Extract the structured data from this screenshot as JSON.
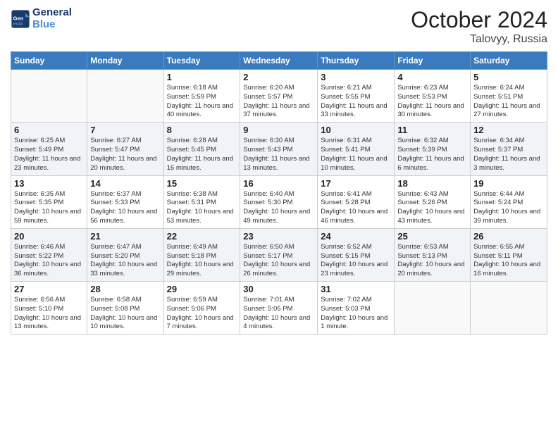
{
  "logo": {
    "line1": "General",
    "line2": "Blue"
  },
  "title": "October 2024",
  "location": "Talovyy, Russia",
  "days_of_week": [
    "Sunday",
    "Monday",
    "Tuesday",
    "Wednesday",
    "Thursday",
    "Friday",
    "Saturday"
  ],
  "weeks": [
    [
      {
        "day": "",
        "info": ""
      },
      {
        "day": "",
        "info": ""
      },
      {
        "day": "1",
        "info": "Sunrise: 6:18 AM\nSunset: 5:59 PM\nDaylight: 11 hours and 40 minutes."
      },
      {
        "day": "2",
        "info": "Sunrise: 6:20 AM\nSunset: 5:57 PM\nDaylight: 11 hours and 37 minutes."
      },
      {
        "day": "3",
        "info": "Sunrise: 6:21 AM\nSunset: 5:55 PM\nDaylight: 11 hours and 33 minutes."
      },
      {
        "day": "4",
        "info": "Sunrise: 6:23 AM\nSunset: 5:53 PM\nDaylight: 11 hours and 30 minutes."
      },
      {
        "day": "5",
        "info": "Sunrise: 6:24 AM\nSunset: 5:51 PM\nDaylight: 11 hours and 27 minutes."
      }
    ],
    [
      {
        "day": "6",
        "info": "Sunrise: 6:25 AM\nSunset: 5:49 PM\nDaylight: 11 hours and 23 minutes."
      },
      {
        "day": "7",
        "info": "Sunrise: 6:27 AM\nSunset: 5:47 PM\nDaylight: 11 hours and 20 minutes."
      },
      {
        "day": "8",
        "info": "Sunrise: 6:28 AM\nSunset: 5:45 PM\nDaylight: 11 hours and 16 minutes."
      },
      {
        "day": "9",
        "info": "Sunrise: 6:30 AM\nSunset: 5:43 PM\nDaylight: 11 hours and 13 minutes."
      },
      {
        "day": "10",
        "info": "Sunrise: 6:31 AM\nSunset: 5:41 PM\nDaylight: 11 hours and 10 minutes."
      },
      {
        "day": "11",
        "info": "Sunrise: 6:32 AM\nSunset: 5:39 PM\nDaylight: 11 hours and 6 minutes."
      },
      {
        "day": "12",
        "info": "Sunrise: 6:34 AM\nSunset: 5:37 PM\nDaylight: 11 hours and 3 minutes."
      }
    ],
    [
      {
        "day": "13",
        "info": "Sunrise: 6:35 AM\nSunset: 5:35 PM\nDaylight: 10 hours and 59 minutes."
      },
      {
        "day": "14",
        "info": "Sunrise: 6:37 AM\nSunset: 5:33 PM\nDaylight: 10 hours and 56 minutes."
      },
      {
        "day": "15",
        "info": "Sunrise: 6:38 AM\nSunset: 5:31 PM\nDaylight: 10 hours and 53 minutes."
      },
      {
        "day": "16",
        "info": "Sunrise: 6:40 AM\nSunset: 5:30 PM\nDaylight: 10 hours and 49 minutes."
      },
      {
        "day": "17",
        "info": "Sunrise: 6:41 AM\nSunset: 5:28 PM\nDaylight: 10 hours and 46 minutes."
      },
      {
        "day": "18",
        "info": "Sunrise: 6:43 AM\nSunset: 5:26 PM\nDaylight: 10 hours and 43 minutes."
      },
      {
        "day": "19",
        "info": "Sunrise: 6:44 AM\nSunset: 5:24 PM\nDaylight: 10 hours and 39 minutes."
      }
    ],
    [
      {
        "day": "20",
        "info": "Sunrise: 6:46 AM\nSunset: 5:22 PM\nDaylight: 10 hours and 36 minutes."
      },
      {
        "day": "21",
        "info": "Sunrise: 6:47 AM\nSunset: 5:20 PM\nDaylight: 10 hours and 33 minutes."
      },
      {
        "day": "22",
        "info": "Sunrise: 6:49 AM\nSunset: 5:18 PM\nDaylight: 10 hours and 29 minutes."
      },
      {
        "day": "23",
        "info": "Sunrise: 6:50 AM\nSunset: 5:17 PM\nDaylight: 10 hours and 26 minutes."
      },
      {
        "day": "24",
        "info": "Sunrise: 6:52 AM\nSunset: 5:15 PM\nDaylight: 10 hours and 23 minutes."
      },
      {
        "day": "25",
        "info": "Sunrise: 6:53 AM\nSunset: 5:13 PM\nDaylight: 10 hours and 20 minutes."
      },
      {
        "day": "26",
        "info": "Sunrise: 6:55 AM\nSunset: 5:11 PM\nDaylight: 10 hours and 16 minutes."
      }
    ],
    [
      {
        "day": "27",
        "info": "Sunrise: 6:56 AM\nSunset: 5:10 PM\nDaylight: 10 hours and 13 minutes."
      },
      {
        "day": "28",
        "info": "Sunrise: 6:58 AM\nSunset: 5:08 PM\nDaylight: 10 hours and 10 minutes."
      },
      {
        "day": "29",
        "info": "Sunrise: 6:59 AM\nSunset: 5:06 PM\nDaylight: 10 hours and 7 minutes."
      },
      {
        "day": "30",
        "info": "Sunrise: 7:01 AM\nSunset: 5:05 PM\nDaylight: 10 hours and 4 minutes."
      },
      {
        "day": "31",
        "info": "Sunrise: 7:02 AM\nSunset: 5:03 PM\nDaylight: 10 hours and 1 minute."
      },
      {
        "day": "",
        "info": ""
      },
      {
        "day": "",
        "info": ""
      }
    ]
  ]
}
